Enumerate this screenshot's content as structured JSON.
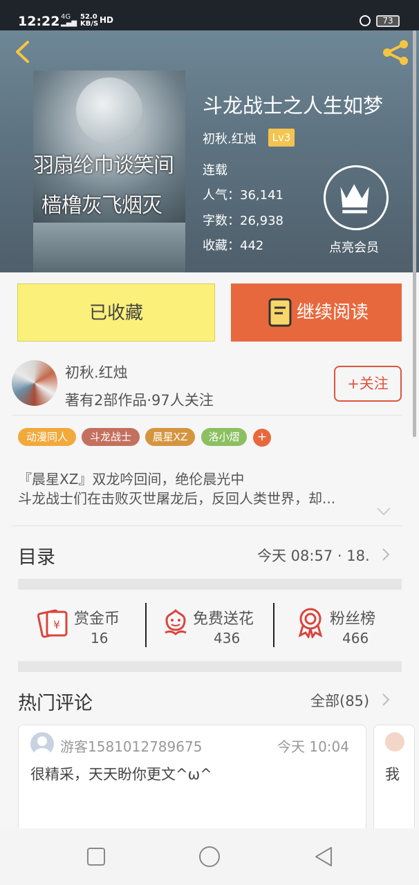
{
  "status_bar": {
    "time": "12:22",
    "network": "4G",
    "speed_value": "52.0",
    "speed_unit": "KB/S",
    "hd": "HD",
    "battery": "73"
  },
  "book": {
    "title": "斗龙战士之人生如梦",
    "author": "初秋.红烛",
    "level": "Lv3",
    "status": "连载",
    "popularity": "人气：36,141",
    "word_count": "字数：26,938",
    "favorites": "收藏：442",
    "vip_label": "点亮会员",
    "cover_text_line1": "羽扇纶巾谈笑间",
    "cover_text_line2": "樯橹灰飞烟灭"
  },
  "actions": {
    "collected_label": "已收藏",
    "continue_label": "继续阅读"
  },
  "author_card": {
    "name": "初秋.红烛",
    "stats": "著有2部作品·97人关注",
    "follow_label": "+关注"
  },
  "tags": [
    {
      "label": "动漫同人",
      "color": "#f2a93b"
    },
    {
      "label": "斗龙战士",
      "color": "#c4705e"
    },
    {
      "label": "晨星XZ",
      "color": "#d5953f"
    },
    {
      "label": "洛小熠",
      "color": "#8cbf62"
    }
  ],
  "tag_more": "+",
  "description": {
    "line1": "『晨星XZ』双龙吟回间，绝伦晨光中",
    "line2": "斗龙战士们在击败灭世屠龙后，反回人类世界，却..."
  },
  "catalog": {
    "title": "目录",
    "update": "今天 08:57 · 18."
  },
  "stats": [
    {
      "label": "赏金币",
      "value": "16",
      "icon": "reward-coin-icon"
    },
    {
      "label": "免费送花",
      "value": "436",
      "icon": "flower-icon"
    },
    {
      "label": "粉丝榜",
      "value": "466",
      "icon": "fan-rank-icon"
    }
  ],
  "comments": {
    "title": "热门评论",
    "all_label": "全部(85)",
    "items": [
      {
        "user": "游客1581012789675",
        "time": "今天 10:04",
        "text": "很精采，天天盼你更文^ω^"
      },
      {
        "user": "",
        "time": "",
        "text": "我"
      }
    ]
  },
  "colors": {
    "accent_orange": "#e8683d",
    "collected_yellow": "#fbf07a",
    "follow_red": "#e0533d",
    "badge_gold": "#f3c44f"
  }
}
